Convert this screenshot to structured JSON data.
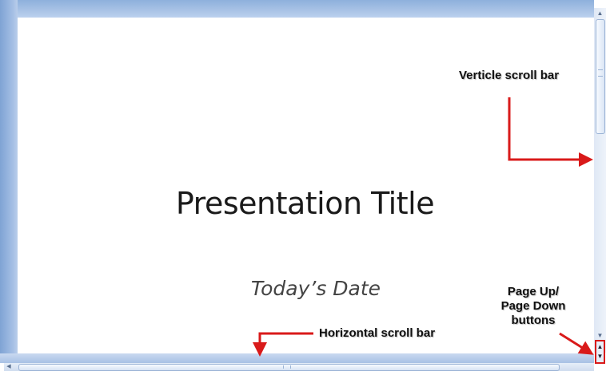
{
  "slide": {
    "title": "Presentation Title",
    "date": "Today’s Date"
  },
  "callouts": {
    "vertical": "Verticle scroll bar",
    "horizontal": "Horizontal scroll bar",
    "page_buttons_line1": "Page Up/",
    "page_buttons_line2": "Page Down",
    "page_buttons_line3": "buttons"
  },
  "icons": {
    "up": "▲",
    "down": "▼",
    "left": "◀",
    "page_up": "▲",
    "page_down": "▼"
  },
  "colors": {
    "frame": "#a9c3e6",
    "annotation_red": "#d91a1a"
  }
}
